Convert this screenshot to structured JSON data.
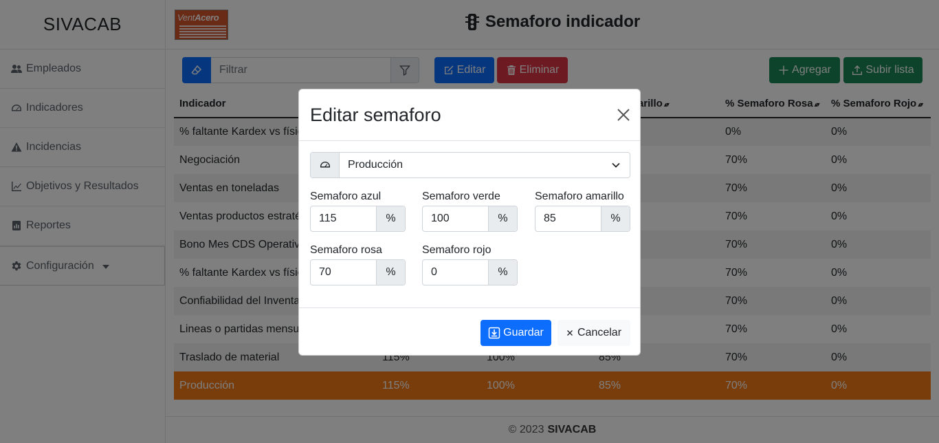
{
  "app": {
    "brand": "SIVACAB",
    "logo_text_a": "Vent",
    "logo_text_b": "Acero"
  },
  "sidebar": {
    "items": [
      {
        "label": "Empleados",
        "icon": "people-icon"
      },
      {
        "label": "Indicadores",
        "icon": "speedometer-icon"
      },
      {
        "label": "Incidencias",
        "icon": "warning-icon"
      },
      {
        "label": "Objetivos y Resultados",
        "icon": "line-chart-icon"
      },
      {
        "label": "Reportes",
        "icon": "report-icon"
      },
      {
        "label": "Configuración",
        "icon": "gear-icon"
      }
    ]
  },
  "header": {
    "title": "Semaforo indicador",
    "icon": "traffic-light-icon"
  },
  "toolbar": {
    "filter_placeholder": "Filtrar",
    "edit_label": "Editar",
    "delete_label": "Eliminar",
    "add_label": "Agregar",
    "upload_label": "Subir lista"
  },
  "table": {
    "columns": [
      "Indicador",
      "",
      "",
      "foro Amarillo",
      "% Semaforo Rosa",
      "% Semaforo Rojo"
    ],
    "rows": [
      {
        "name": "% faltante Kardex vs físic",
        "azul": "",
        "verde": "",
        "amarillo": "",
        "rosa": "0%",
        "rojo": "0%"
      },
      {
        "name": "Negociación",
        "azul": "",
        "verde": "",
        "amarillo": "",
        "rosa": "70%",
        "rojo": "0%"
      },
      {
        "name": "Ventas en toneladas",
        "azul": "",
        "verde": "",
        "amarillo": "",
        "rosa": "70%",
        "rojo": "0%"
      },
      {
        "name": "Ventas productos estraté",
        "azul": "",
        "verde": "",
        "amarillo": "",
        "rosa": "70%",
        "rojo": "0%"
      },
      {
        "name": "Bono Mes CDS Operativo",
        "azul": "",
        "verde": "",
        "amarillo": "",
        "rosa": "70%",
        "rojo": "0%"
      },
      {
        "name": "% faltante Kardex vs físic",
        "azul": "",
        "verde": "",
        "amarillo": "",
        "rosa": "70%",
        "rojo": "0%"
      },
      {
        "name": "Confiabilidad del Inventa",
        "azul": "",
        "verde": "",
        "amarillo": "",
        "rosa": "70%",
        "rojo": "0%"
      },
      {
        "name": "Lineas o partidas mensua",
        "azul": "",
        "verde": "",
        "amarillo": "",
        "rosa": "70%",
        "rojo": "0%"
      },
      {
        "name": "Traslado de material",
        "azul": "115%",
        "verde": "100%",
        "amarillo": "85%",
        "rosa": "70%",
        "rojo": "0%"
      },
      {
        "name": "Producción",
        "azul": "115%",
        "verde": "100%",
        "amarillo": "85%",
        "rosa": "70%",
        "rojo": "0%"
      }
    ]
  },
  "footer": {
    "copyright": "© 2023",
    "brand": "SIVACAB"
  },
  "modal": {
    "title": "Editar semaforo",
    "selected_indicator": "Producción",
    "fields": {
      "azul": {
        "label": "Semaforo azul",
        "value": "115",
        "unit": "%"
      },
      "verde": {
        "label": "Semaforo verde",
        "value": "100",
        "unit": "%"
      },
      "amarillo": {
        "label": "Semaforo amarillo",
        "value": "85",
        "unit": "%"
      },
      "rosa": {
        "label": "Semaforo rosa",
        "value": "70",
        "unit": "%"
      },
      "rojo": {
        "label": "Semaforo rojo",
        "value": "0",
        "unit": "%"
      }
    },
    "save_label": "Guardar",
    "cancel_label": "Cancelar"
  },
  "colors": {
    "primary": "#0d6efd",
    "danger": "#dc3545",
    "success": "#198754",
    "selected_row": "#f07b17"
  }
}
